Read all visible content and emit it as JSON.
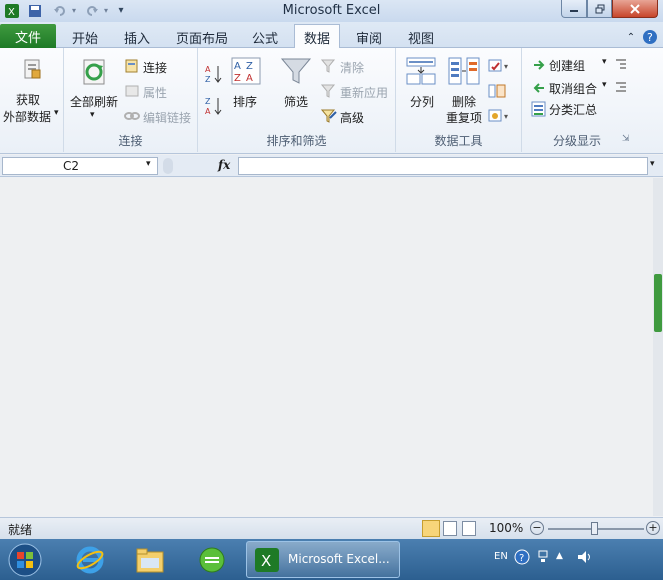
{
  "window": {
    "title": "Microsoft Excel"
  },
  "tabs": {
    "file": "文件",
    "home": "开始",
    "insert": "插入",
    "page_layout": "页面布局",
    "formulas": "公式",
    "data": "数据",
    "review": "审阅",
    "view": "视图"
  },
  "ribbon": {
    "get_external": {
      "line1": "获取",
      "line2": "外部数据"
    },
    "connections": {
      "refresh_all": "全部刷新",
      "connections": "连接",
      "properties": "属性",
      "edit_links": "编辑链接",
      "label": "连接"
    },
    "sort_filter": {
      "sort": "排序",
      "filter": "筛选",
      "clear": "清除",
      "reapply": "重新应用",
      "advanced": "高级",
      "label": "排序和筛选"
    },
    "data_tools": {
      "text_to_columns": "分列",
      "remove_dup_1": "删除",
      "remove_dup_2": "重复项",
      "label": "数据工具"
    },
    "outline": {
      "group": "创建组",
      "ungroup": "取消组合",
      "subtotal": "分类汇总",
      "label": "分级显示"
    }
  },
  "formula_bar": {
    "name_box": "C2",
    "fx": "fx"
  },
  "status_bar": {
    "ready": "就绪",
    "zoom": "100%"
  },
  "taskbar": {
    "excel_label": "Microsoft Excel...",
    "lang": "EN"
  },
  "colors": {
    "accent": "#1e7a26",
    "taskbar": "#2c5f90"
  }
}
